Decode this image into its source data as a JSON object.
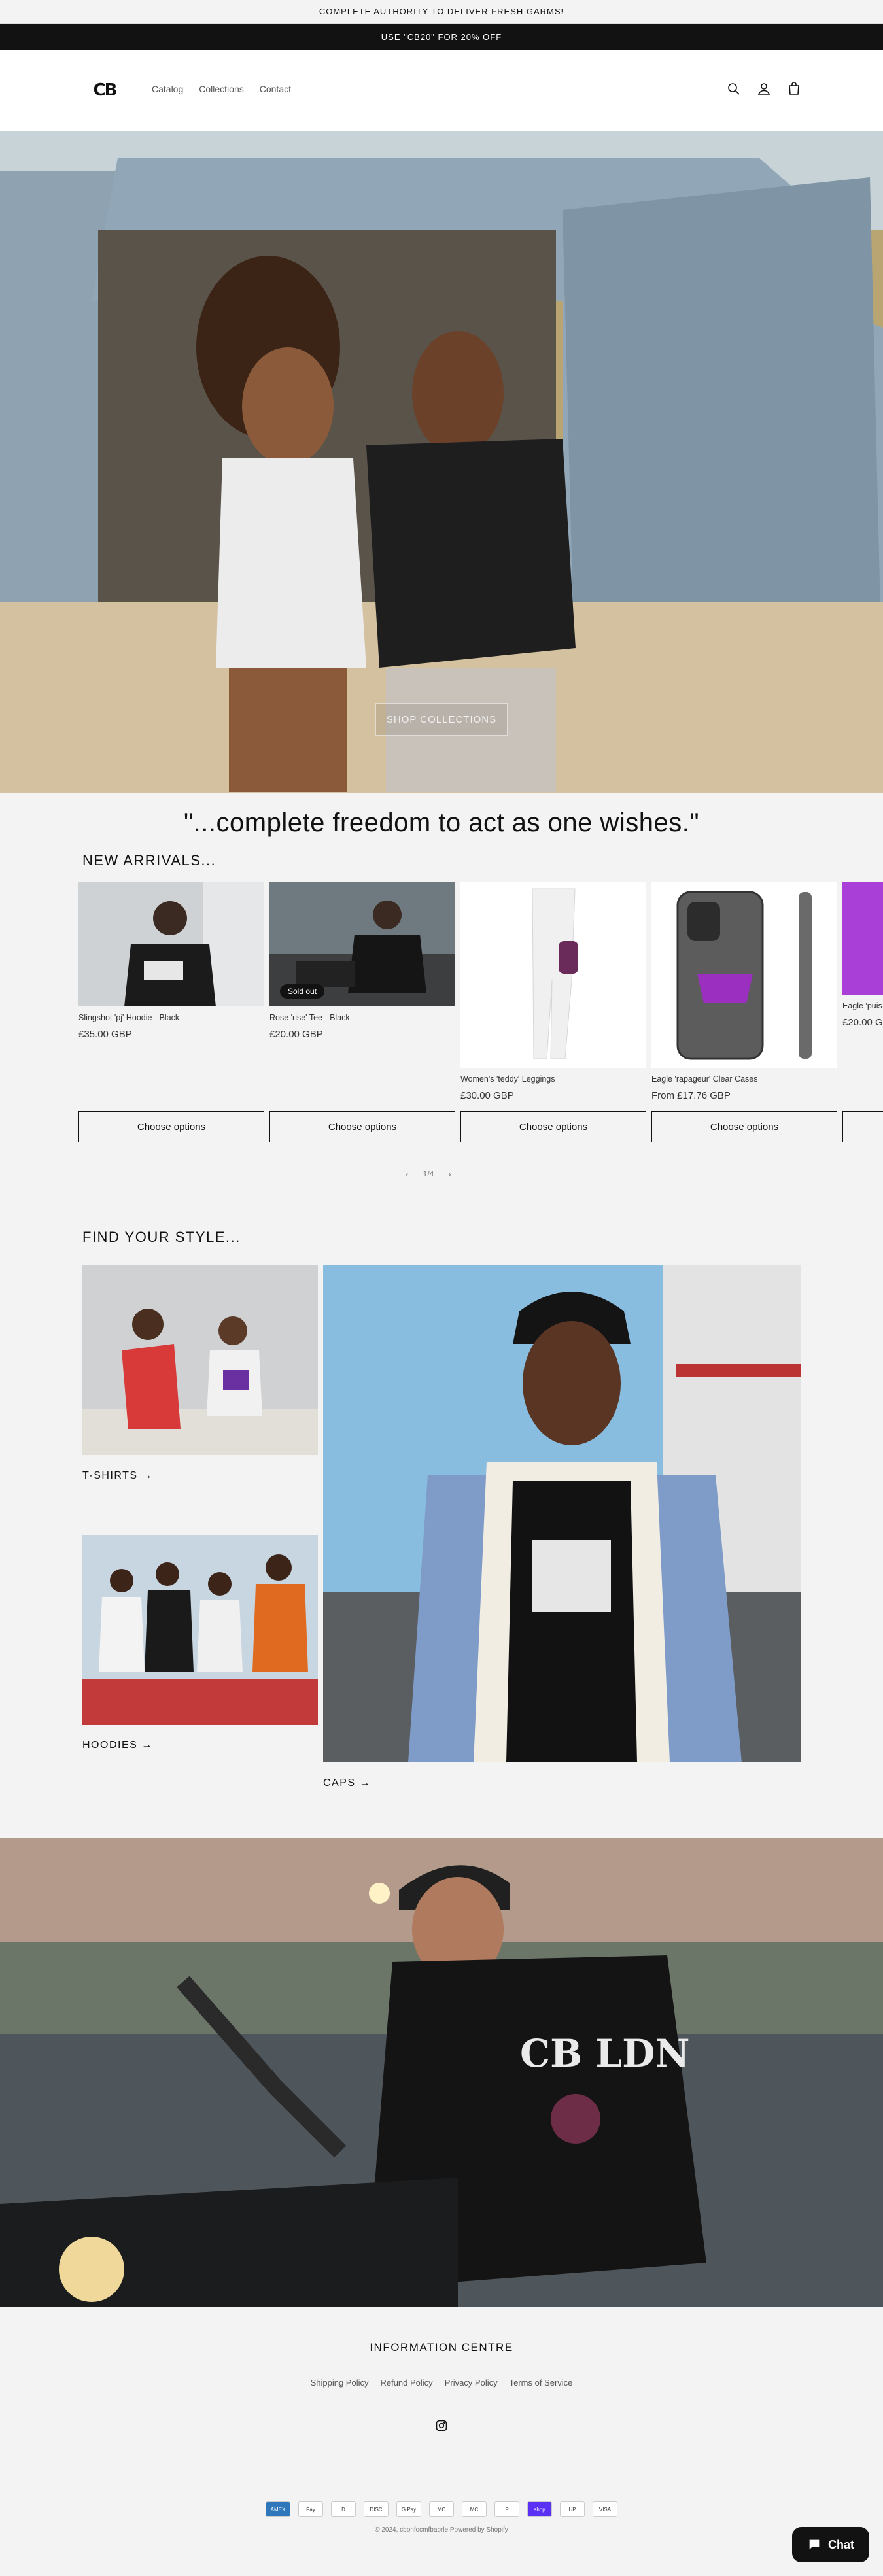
{
  "announcements": [
    "COMPLETE AUTHORITY TO DELIVER FRESH GARMS!",
    "USE \"CB20\" FOR 20% OFF"
  ],
  "header": {
    "logo_text": "CB",
    "nav": [
      "Catalog",
      "Collections",
      "Contact"
    ]
  },
  "hero": {
    "button_label": "SHOP COLLECTIONS"
  },
  "quote": "\"...complete freedom to act as one wishes.\"",
  "new_arrivals": {
    "title": "NEW ARRIVALS...",
    "products": [
      {
        "title": "Slingshot 'pj' Hoodie - Black",
        "price": "£35.00 GBP",
        "sold_out": ""
      },
      {
        "title": "Rose 'rise' Tee - Black",
        "price": "£20.00 GBP",
        "sold_out": "Sold out"
      },
      {
        "title": "Women's 'teddy' Leggings",
        "price": "£30.00 GBP",
        "sold_out": ""
      },
      {
        "title": "Eagle 'rapageur' Clear Cases",
        "price": "From £17.76 GBP",
        "sold_out": ""
      },
      {
        "title": "Eagle 'puis",
        "price": "£20.00 G",
        "sold_out": ""
      }
    ],
    "button_label": "Choose options",
    "pager": "1/4"
  },
  "find_style": {
    "title": "FIND YOUR STYLE...",
    "collections": [
      "T-SHIRTS →",
      "HOODIES →",
      "CAPS →"
    ]
  },
  "footer": {
    "heading": "INFORMATION CENTRE",
    "links": [
      "Shipping Policy",
      "Refund Policy",
      "Privacy Policy",
      "Terms of Service"
    ],
    "payments": [
      "AMEX",
      "Pay",
      "D",
      "DISC",
      "G Pay",
      "MC",
      "MC",
      "P",
      "shop",
      "UP",
      "VISA"
    ],
    "copyright": "© 2024, cbonfocmfbabrle Powered by Shopify"
  },
  "chat": {
    "label": "Chat"
  },
  "colors": {
    "dark": "#121212",
    "background": "#f3f3f3"
  }
}
